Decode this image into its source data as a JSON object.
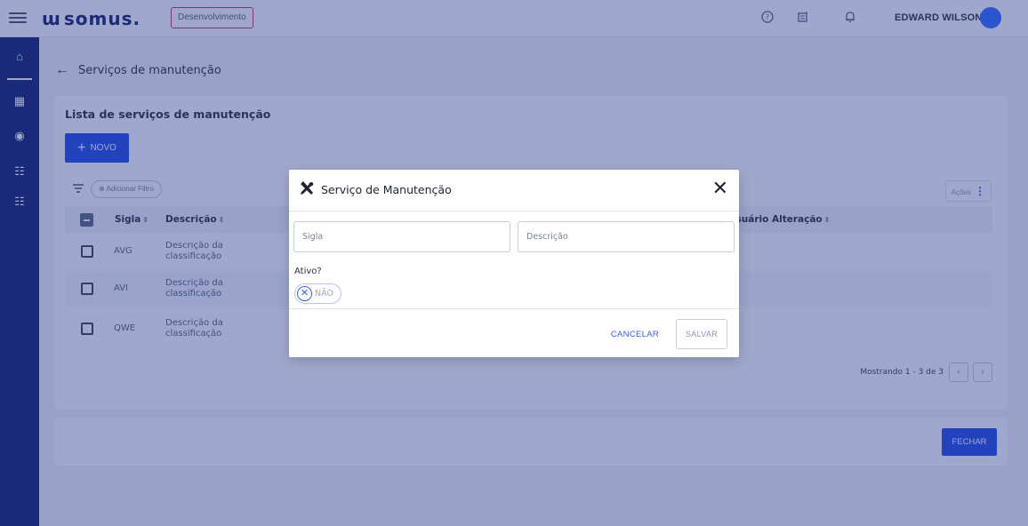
{
  "header": {
    "logo_mark": "ɯ",
    "logo_text": "somus.",
    "environment": "Desenvolvimento",
    "user_name": "EDWARD WILSON",
    "icons": [
      "help-icon",
      "notes-icon",
      "bell-icon"
    ]
  },
  "sidebar": {
    "items": [
      {
        "icon": "home-icon",
        "glyph": "⌂"
      },
      {
        "icon": "dashboard-icon",
        "glyph": "▦"
      },
      {
        "icon": "map-pin-icon",
        "glyph": "◉"
      },
      {
        "icon": "list-add-icon",
        "glyph": "☷"
      },
      {
        "icon": "list-add-icon-2",
        "glyph": "☷"
      }
    ]
  },
  "page": {
    "back_glyph": "←",
    "title": "Serviços de manutenção"
  },
  "card": {
    "title": "Lista de serviços de manutenção",
    "new_button": "NOVO",
    "add_filter": "Adicionar Filtro",
    "actions": "Ações",
    "columns": {
      "sigla": "Sigla",
      "descricao": "Descrição",
      "usuario_alteracao": "Usuário Alteração"
    },
    "rows": [
      {
        "sigla": "AVG",
        "descricao": "Descrição da classificação"
      },
      {
        "sigla": "AVI",
        "descricao": "Descrição da classificação"
      },
      {
        "sigla": "QWE",
        "descricao": "Descrição da classificação"
      }
    ],
    "pagination_text": "Mostrando 1 - 3 de 3"
  },
  "footer": {
    "close_button": "FECHAR"
  },
  "modal": {
    "title": "Serviço de Manutenção",
    "title_icon": "tools-icon",
    "sigla_placeholder": "Sigla",
    "descricao_placeholder": "Descrição",
    "ativo_label": "Ativo?",
    "toggle_value": "NÃO",
    "cancel_button": "CANCELAR",
    "save_button": "SALVAR"
  },
  "colors": {
    "primary": "#2349e6",
    "sidebar": "#0f1f6b",
    "badge_border": "#c8365a",
    "overlay": "#243a8c"
  }
}
